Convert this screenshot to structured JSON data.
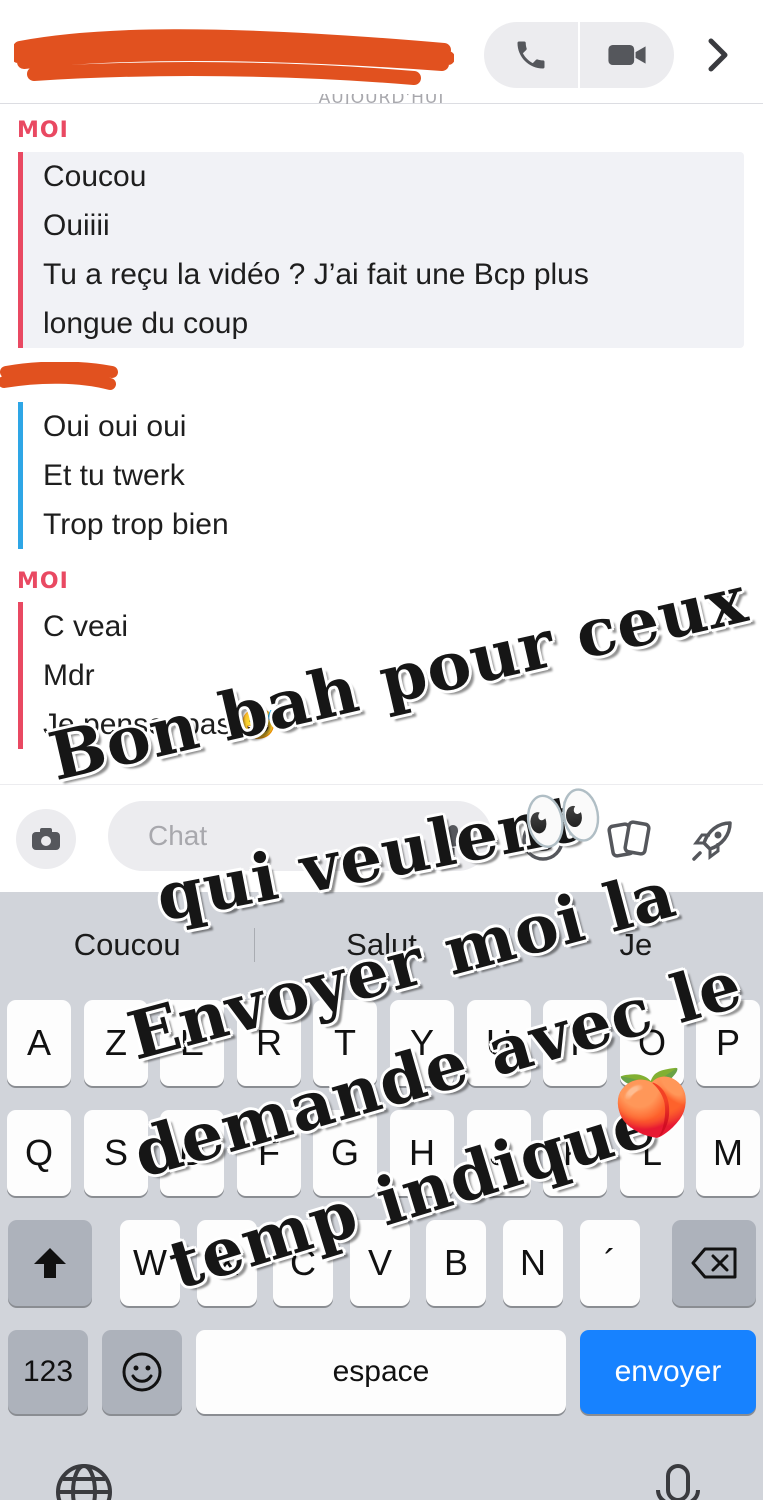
{
  "header": {
    "title_redacted": "redacted-contact-name",
    "call_icon": "phone-icon",
    "video_icon": "video-camera-icon",
    "more_icon": "chevron-right-icon",
    "date_separator": "AUJOURD'HUI"
  },
  "colors": {
    "me_accent": "#e94962",
    "them_accent": "#2ea6e6",
    "redaction": "#e1511f",
    "send_button": "#1782ff",
    "keyboard_bg": "#d1d4da"
  },
  "conversation": [
    {
      "sender": "MOI",
      "messages": [
        "Coucou",
        "Ouiiii",
        "Tu a reçu la vidéo ? J’ai fait une Bcp plus",
        "longue du coup"
      ]
    },
    {
      "sender": "",
      "messages": [
        "Oui oui oui",
        "Et tu twerk",
        "Trop trop bien"
      ]
    },
    {
      "sender": "MOI",
      "messages": [
        "C veai",
        "Mdr",
        "Je penser pas 😅"
      ]
    }
  ],
  "input_bar": {
    "placeholder": "Chat",
    "icons": [
      "camera-icon",
      "microphone-icon",
      "sticker-icon",
      "memories-icon",
      "rocket-icon"
    ]
  },
  "keyboard": {
    "suggestions": [
      "Coucou",
      "Salut",
      "Je"
    ],
    "rows": [
      [
        "A",
        "Z",
        "E",
        "R",
        "T",
        "Y",
        "U",
        "I",
        "O",
        "P"
      ],
      [
        "Q",
        "S",
        "D",
        "F",
        "G",
        "H",
        "J",
        "K",
        "L",
        "M"
      ],
      [
        "W",
        "X",
        "C",
        "V",
        "B",
        "N",
        "´"
      ]
    ],
    "numbers_key": "123",
    "space_key": "espace",
    "send_key": "envoyer",
    "icons": [
      "shift-icon",
      "backspace-icon",
      "emoji-icon",
      "globe-icon",
      "dictation-icon"
    ]
  },
  "overlay_caption": {
    "lines": [
      "Bon bah pour ceux",
      "qui veulent",
      "Envoyer moi la",
      "demande avec le",
      "temp indiqué"
    ],
    "emojis": [
      "👀",
      "🍑"
    ]
  }
}
